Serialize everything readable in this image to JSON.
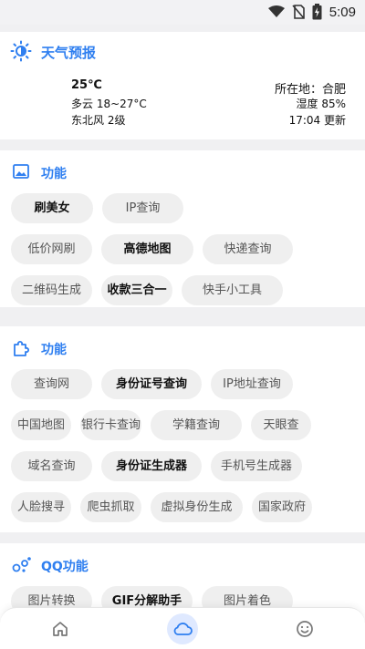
{
  "status_bar": {
    "time": "5:09"
  },
  "weather": {
    "title": "天气预报",
    "temp": "25℃",
    "condition": "多云 18~27°C",
    "wind": "东北风 2级",
    "location": "所在地：合肥",
    "humidity": "湿度 85%",
    "updated": "17:04 更新"
  },
  "section1": {
    "title": "功能",
    "rows": [
      [
        {
          "label": "刷美女",
          "bold": true
        },
        {
          "label": "IP查询",
          "bold": false
        }
      ],
      [
        {
          "label": "低价网刷",
          "bold": false
        },
        {
          "label": "高德地图",
          "bold": true
        },
        {
          "label": "快递查询",
          "bold": false
        }
      ],
      [
        {
          "label": "二维码生成",
          "bold": false
        },
        {
          "label": "收款三合一",
          "bold": true
        },
        {
          "label": "快手小工具",
          "bold": false
        }
      ]
    ]
  },
  "section2": {
    "title": "功能",
    "rows": [
      [
        {
          "label": "查询网",
          "bold": false
        },
        {
          "label": "身份证号查询",
          "bold": true
        },
        {
          "label": "IP地址查询",
          "bold": false
        }
      ],
      [
        {
          "label": "中国地图",
          "bold": false
        },
        {
          "label": "银行卡查询",
          "bold": false
        },
        {
          "label": "学籍查询",
          "bold": false
        },
        {
          "label": "天眼查",
          "bold": false
        }
      ],
      [
        {
          "label": "域名查询",
          "bold": false
        },
        {
          "label": "身份证生成器",
          "bold": true
        },
        {
          "label": "手机号生成器",
          "bold": false
        }
      ],
      [
        {
          "label": "人脸搜寻",
          "bold": false
        },
        {
          "label": "爬虫抓取",
          "bold": false
        },
        {
          "label": "虚拟身份生成",
          "bold": false
        },
        {
          "label": "国家政府",
          "bold": false
        }
      ]
    ]
  },
  "section3": {
    "title": "QQ功能",
    "rows": [
      [
        {
          "label": "图片转换",
          "bold": false
        },
        {
          "label": "GIF分解助手",
          "bold": true
        },
        {
          "label": "图片着色",
          "bold": false
        }
      ]
    ]
  },
  "bottom_nav": [
    {
      "icon": "home-icon"
    },
    {
      "icon": "cloud-icon",
      "active": true
    },
    {
      "icon": "smile-icon"
    }
  ],
  "colors": {
    "accent": "#2f7ff0",
    "chip_bg": "#efefef",
    "page_bg": "#f0f0f2"
  }
}
